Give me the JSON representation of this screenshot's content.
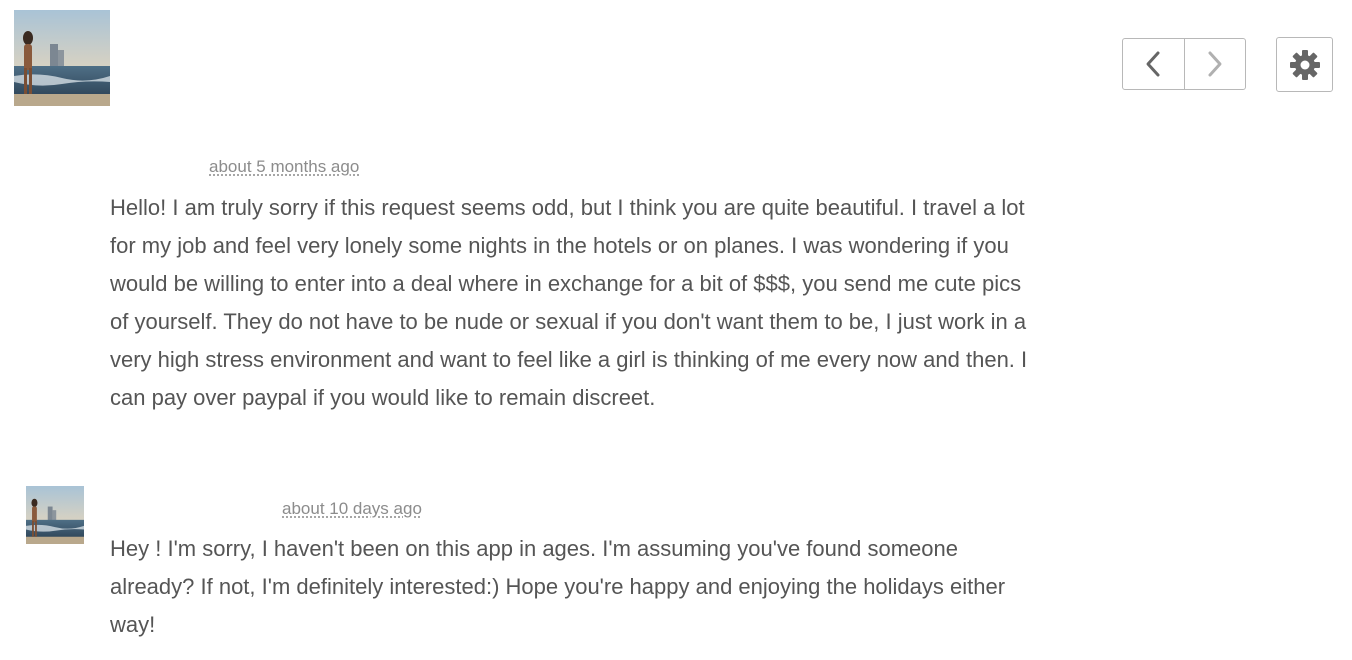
{
  "header": {
    "avatar_icon": "user-avatar-photo",
    "nav": {
      "prev_icon": "chevron-left-icon",
      "next_icon": "chevron-right-icon"
    },
    "settings_icon": "gear-icon"
  },
  "messages": [
    {
      "timestamp": "about 5 months ago",
      "text": "Hello! I am truly sorry if this request seems odd, but I think you are quite beautiful. I travel a lot for my job and feel very lonely some nights in the hotels or on planes. I was wondering if you would be willing to enter into a deal where in exchange for a bit of $$$, you send me cute pics of yourself. They do not have to be nude or sexual if you don't want them to be, I just work in a very high stress environment and want to feel like a girl is thinking of me every now and then. I can pay over paypal if you would like to remain discreet."
    },
    {
      "timestamp": "about 10 days ago",
      "text": "Hey ! I'm sorry, I haven't been on this app in ages. I'm assuming you've found someone already? If not, I'm definitely interested:) Hope you're happy and enjoying the holidays either way!"
    }
  ],
  "colors": {
    "text": "#555555",
    "timestamp": "#8c8c8c",
    "border": "#b8b8b8",
    "icon": "#666666"
  }
}
